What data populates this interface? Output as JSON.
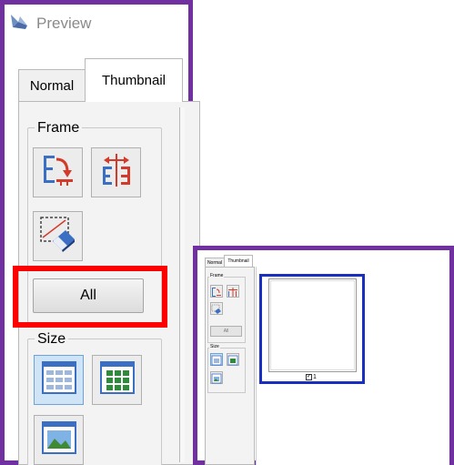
{
  "window": {
    "title": "Preview"
  },
  "tabs": {
    "normal": "Normal",
    "thumbnail": "Thumbnail"
  },
  "frame_group": {
    "legend": "Frame",
    "buttons": [
      "frame-fit-icon",
      "frame-width-icon",
      "frame-erase-icon"
    ],
    "all_button_label": "All"
  },
  "size_group": {
    "legend": "Size",
    "buttons": [
      "thumbnail-small-grid-icon",
      "thumbnail-medium-grid-icon",
      "thumbnail-large-image-icon"
    ]
  },
  "small_view": {
    "tabs": {
      "normal": "Normal",
      "thumbnail": "Thumbnail"
    },
    "frame_legend": "Frame",
    "all_button_label": "All",
    "size_legend": "Size",
    "page_checkbox_checked": true,
    "page_label": "1"
  },
  "colors": {
    "callout_border": "#7030a0",
    "highlight": "#ff0000",
    "thumbnail_frame": "#1a2fbf"
  }
}
